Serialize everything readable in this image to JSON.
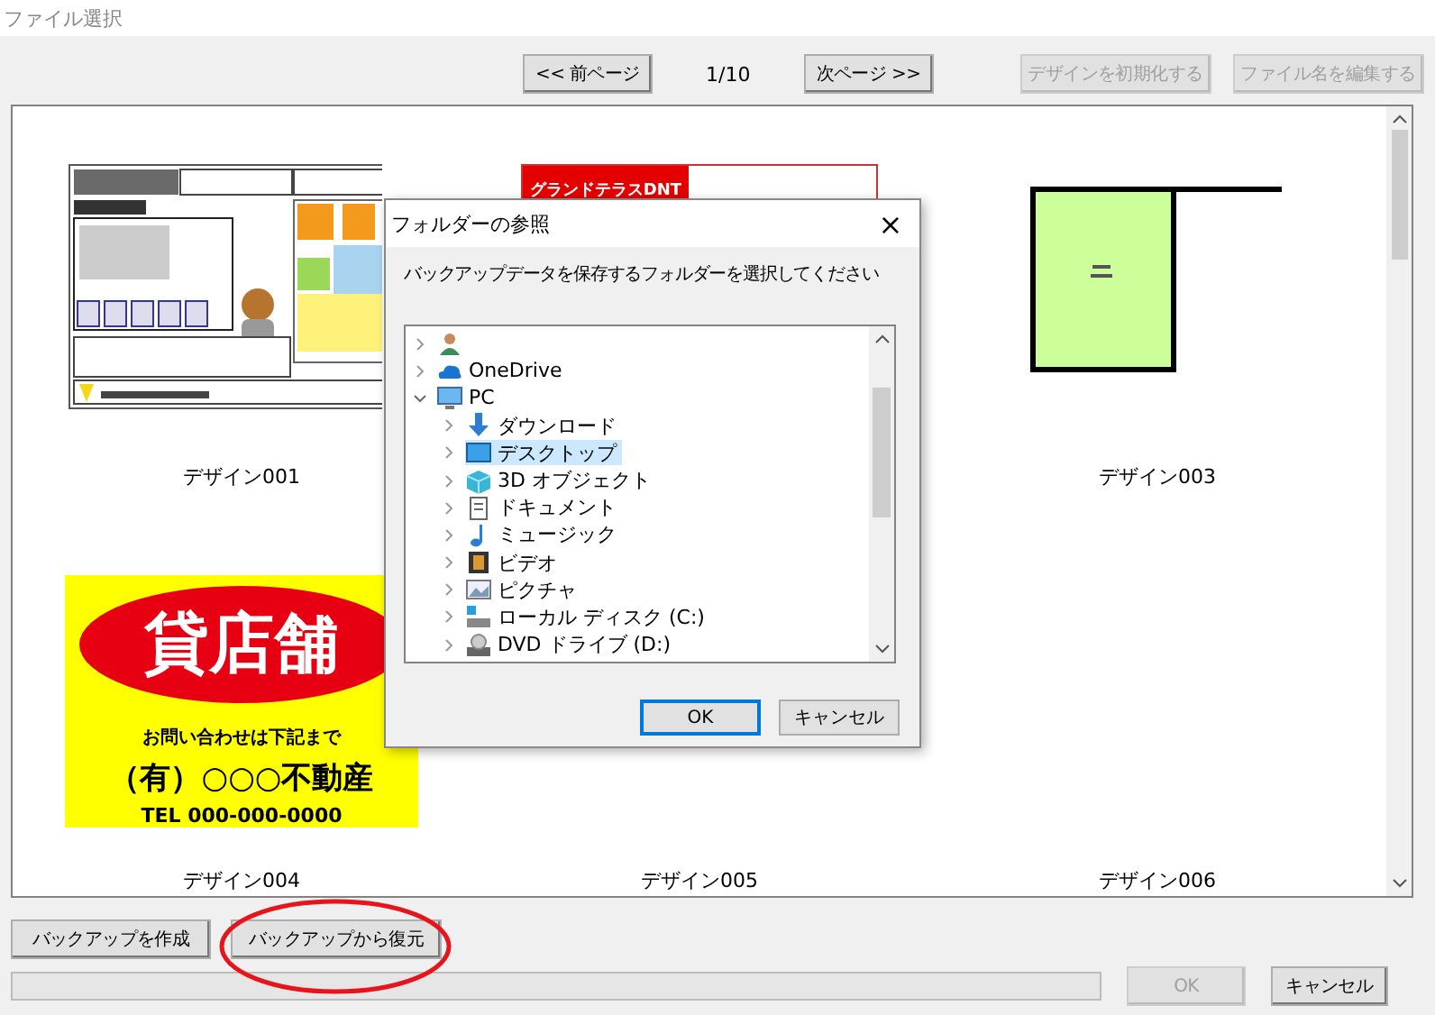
{
  "window": {
    "title": "ファイル選択"
  },
  "pager": {
    "prev": "<< 前ページ",
    "page": "1/10",
    "next": "次ページ >>"
  },
  "toolbar_buttons": [
    {
      "label": "デザインを初期化する",
      "disabled": true
    },
    {
      "label": "ファイル名を編集する",
      "disabled": true
    }
  ],
  "designs": [
    {
      "kind": "flyer",
      "name": "デザイン001"
    },
    {
      "kind": "banner",
      "texts": [
        "グランドテラスDNT"
      ]
    },
    {
      "kind": "floorplan",
      "name": "デザイン003"
    },
    {
      "kind": "shop",
      "name": "デザイン004",
      "texts": [
        "貸店舗",
        "お問い合わせは下記まで",
        "（有）○○○不動産",
        "TEL 000-000-0000"
      ]
    },
    {
      "kind": "blank",
      "name": "デザイン005"
    },
    {
      "kind": "blank",
      "name": "デザイン006"
    }
  ],
  "backup_buttons": [
    "バックアップを作成",
    "バックアップから復元"
  ],
  "progress": {
    "level": 0
  },
  "buttons": [
    {
      "label": "OK",
      "disabled": true
    },
    {
      "label": "キャンセル",
      "disabled": false
    }
  ],
  "dialog": {
    "title": "フォルダーの参照",
    "close": "×",
    "prompt": "バックアップデータを保存するフォルダーを選択してください",
    "tree": [
      {
        "expanded": false,
        "selected": false
      },
      {
        "label": "OneDrive",
        "expanded": false,
        "selected": false
      },
      {
        "label": "PC",
        "expanded": true,
        "selected": false,
        "children": [
          {
            "label": "ダウンロード",
            "expanded": false,
            "selected": false
          },
          {
            "label": "デスクトップ",
            "expanded": false,
            "selected": true
          },
          {
            "label": "3D オブジェクト",
            "expanded": false,
            "selected": false
          },
          {
            "label": "ドキュメント",
            "expanded": false,
            "selected": false
          },
          {
            "label": "ミュージック",
            "expanded": false,
            "selected": false
          },
          {
            "label": "ビデオ",
            "expanded": false,
            "selected": false
          },
          {
            "label": "ピクチャ",
            "expanded": false,
            "selected": false
          },
          {
            "label": "ローカル ディスク (C:)",
            "expanded": false,
            "selected": false
          },
          {
            "label": "DVD ドライブ (D:)",
            "expanded": false,
            "selected": false
          }
        ]
      }
    ],
    "buttons": [
      {
        "label": "OK",
        "default": true
      },
      {
        "label": "キャンセル",
        "default": false
      }
    ]
  }
}
